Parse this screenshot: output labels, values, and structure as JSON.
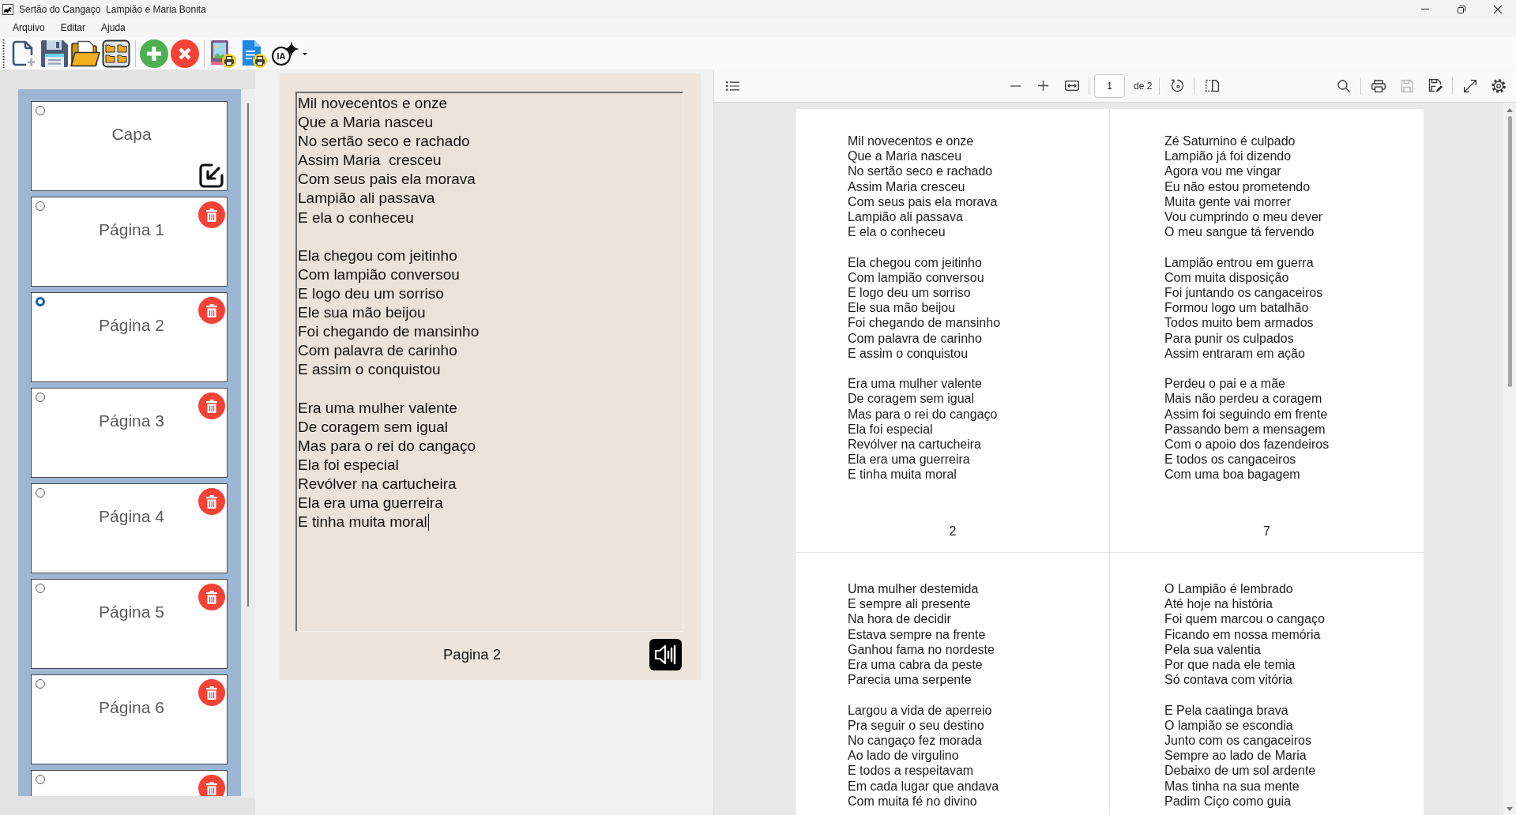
{
  "window": {
    "title": "Sertão do Cangaço  Lampião e Maria Bonita"
  },
  "menu": [
    "Arquivo",
    "Editar",
    "Ajuda"
  ],
  "toolbar": {
    "ai_button": {
      "label": "IA"
    }
  },
  "sidebar": {
    "pages": [
      {
        "kind": "cover",
        "label": "Capa",
        "selected": false
      },
      {
        "kind": "page",
        "label": "Página 1",
        "selected": false
      },
      {
        "kind": "page",
        "label": "Página 2",
        "selected": true
      },
      {
        "kind": "page",
        "label": "Página 3",
        "selected": false
      },
      {
        "kind": "page",
        "label": "Página 4",
        "selected": false
      },
      {
        "kind": "page",
        "label": "Página 5",
        "selected": false
      },
      {
        "kind": "page",
        "label": "Página 6",
        "selected": false
      },
      {
        "kind": "page",
        "selected": false
      }
    ]
  },
  "editor": {
    "focused": true,
    "stanzas": [
      [
        "Mil novecentos e onze",
        "Que a Maria nasceu",
        "No sertão seco e rachado",
        "Assim Maria  cresceu",
        "Com seus pais ela morava",
        "Lampião ali passava",
        "E ela o conheceu"
      ],
      [
        "Ela chegou com jeitinho",
        "Com lampião conversou",
        "E logo deu um sorriso",
        "Ele sua mão beijou",
        "Foi chegando de mansinho",
        "Com palavra de carinho",
        "E assim o conquistou"
      ],
      [
        "Era uma mulher valente",
        "De coragem sem igual",
        "Mas para o rei do cangaço",
        "Ela foi especial",
        "Revólver na cartucheira",
        "Ela era uma guerreira",
        "E tinha muita moral"
      ]
    ],
    "caption": "Pagina 2"
  },
  "viewer": {
    "toolbar": {
      "page_field": "1",
      "page_count": "de 2",
      "save_disabled": true
    },
    "sheets": [
      {
        "stanzas": [
          [
            "Mil novecentos e onze",
            "Que a Maria nasceu",
            "No sertão seco e rachado",
            "Assim Maria cresceu",
            "Com seus pais ela morava",
            "Lampião ali passava",
            "E ela o conheceu"
          ],
          [
            "Ela chegou com jeitinho",
            "Com lampião conversou",
            "E logo deu um sorriso",
            "Ele sua mão beijou",
            "Foi chegando de mansinho",
            "Com palavra de carinho",
            "E assim o conquistou"
          ],
          [
            "Era uma mulher valente",
            "De coragem sem igual",
            "Mas para o rei do cangaço",
            "Ela foi especial",
            "Revólver na cartucheira",
            "Ela era uma guerreira",
            "E tinha muita moral"
          ]
        ],
        "page_number": "2"
      },
      {
        "stanzas": [
          [
            "Zé Saturnino é culpado",
            "Lampião já foi dizendo",
            "Agora vou me vingar",
            "Eu não estou prometendo",
            "Muita gente vai morrer",
            "Vou cumprindo o meu dever",
            "O meu sangue tá fervendo"
          ],
          [
            "Lampião entrou em guerra",
            "Com muita disposição",
            "Foi juntando os cangaceiros",
            "Formou logo um batalhão",
            "Todos muito bem armados",
            "Para punir os culpados",
            "Assim entraram em ação"
          ],
          [
            "Perdeu o pai e a mãe",
            "Mais não perdeu a coragem",
            "Assim foi seguindo em frente",
            "Passando bem a mensagem",
            "Com o apoio dos fazendeiros",
            "E todos os cangaceiros",
            "Com uma boa bagagem"
          ]
        ],
        "page_number": "7"
      },
      {
        "stanzas": [
          [
            "Uma mulher destemida",
            "E sempre ali presente",
            "Na hora de decidir",
            "Estava sempre na frente",
            "Ganhou fama no nordeste",
            "Era uma cabra da peste",
            "Parecia uma serpente"
          ],
          [
            "Largou a vida de aperreio",
            "Pra seguir o seu destino",
            "No cangaço fez morada",
            "Ao lado de virgulino",
            "E todos a respeitavam",
            "Em cada lugar que andava",
            "Com muita fé no divino"
          ]
        ]
      },
      {
        "stanzas": [
          [
            "O Lampião é lembrado",
            "Até hoje na história",
            "Foi quem marcou o cangaço",
            "Ficando em nossa memória",
            "Pela sua valentia",
            "Por que nada ele temia",
            "Só contava com vitória"
          ],
          [
            "E Pela caatinga brava",
            "O lampião se escondia",
            "Junto com os cangaceiros",
            "Sempre ao lado de Maria",
            "Debaixo de um sol ardente",
            "Mas tinha na sua mente",
            "Padim Ciço como guia"
          ]
        ]
      }
    ]
  }
}
